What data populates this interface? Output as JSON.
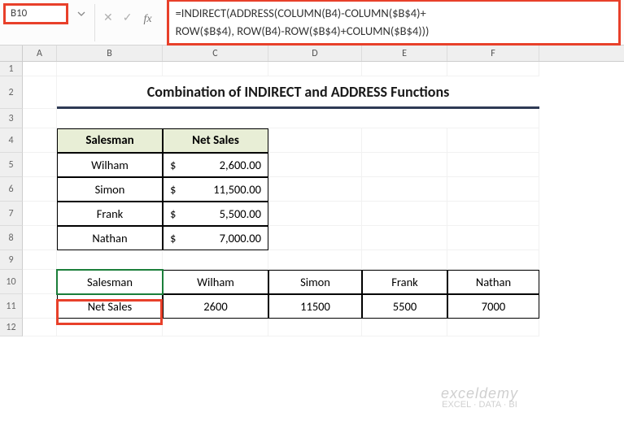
{
  "nameBox": "B10",
  "formula": "=INDIRECT(ADDRESS(COLUMN(B4)-COLUMN($B$4)+\nROW($B$4), ROW(B4)-ROW($B$4)+COLUMN($B$4)))",
  "columns": [
    "A",
    "B",
    "C",
    "D",
    "E",
    "F"
  ],
  "rowsVisible": [
    "1",
    "2",
    "3",
    "4",
    "5",
    "6",
    "7",
    "8",
    "9",
    "10",
    "11",
    "12"
  ],
  "title": "Combination of INDIRECT and ADDRESS Functions",
  "table1": {
    "headers": [
      "Salesman",
      "Net Sales"
    ],
    "rows": [
      {
        "name": "Wilham",
        "currency": "$",
        "value": "2,600.00"
      },
      {
        "name": "Simon",
        "currency": "$",
        "value": "11,500.00"
      },
      {
        "name": "Frank",
        "currency": "$",
        "value": "5,500.00"
      },
      {
        "name": "Nathan",
        "currency": "$",
        "value": "7,000.00"
      }
    ]
  },
  "table2": {
    "row1": [
      "Salesman",
      "Wilham",
      "Simon",
      "Frank",
      "Nathan"
    ],
    "row2": [
      "Net Sales",
      "2600",
      "11500",
      "5500",
      "7000"
    ]
  },
  "watermark": {
    "line1": "exceldemy",
    "line2": "EXCEL · DATA · BI"
  }
}
